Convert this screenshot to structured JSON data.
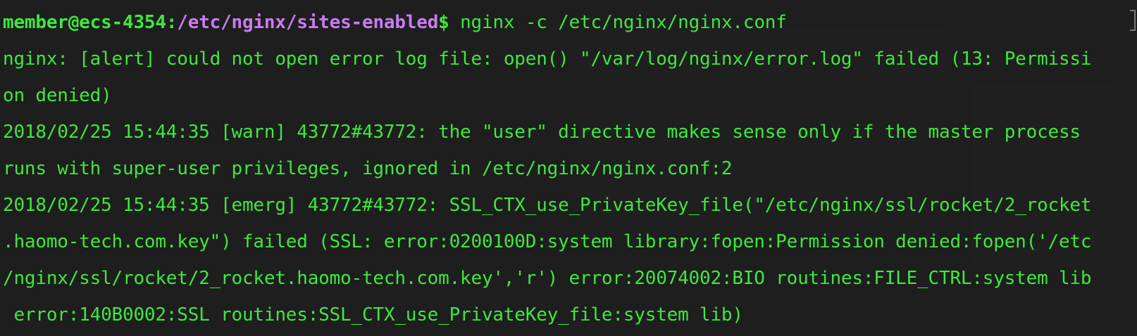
{
  "terminal": {
    "prompt": {
      "user_host": "member@ecs-4354",
      "colon": ":",
      "path": "/etc/nginx/sites-enabled",
      "dollar": "$",
      "command": " nginx -c /etc/nginx/nginx.conf"
    },
    "output_lines": [
      "nginx: [alert] could not open error log file: open() \"/var/log/nginx/error.log\" failed (13: Permissi",
      "on denied)",
      "2018/02/25 15:44:35 [warn] 43772#43772: the \"user\" directive makes sense only if the master process",
      "runs with super-user privileges, ignored in /etc/nginx/nginx.conf:2",
      "2018/02/25 15:44:35 [emerg] 43772#43772: SSL_CTX_use_PrivateKey_file(\"/etc/nginx/ssl/rocket/2_rocket",
      ".haomo-tech.com.key\") failed (SSL: error:0200100D:system library:fopen:Permission denied:fopen('/etc",
      "/nginx/ssl/rocket/2_rocket.haomo-tech.com.key','r') error:20074002:BIO routines:FILE_CTRL:system lib",
      " error:140B0002:SSL routines:SSL_CTX_use_PrivateKey_file:system lib)"
    ],
    "colors": {
      "text_green": "#3ee83e",
      "path_purple": "#c97bf0",
      "background": "#1e1e1e"
    }
  }
}
